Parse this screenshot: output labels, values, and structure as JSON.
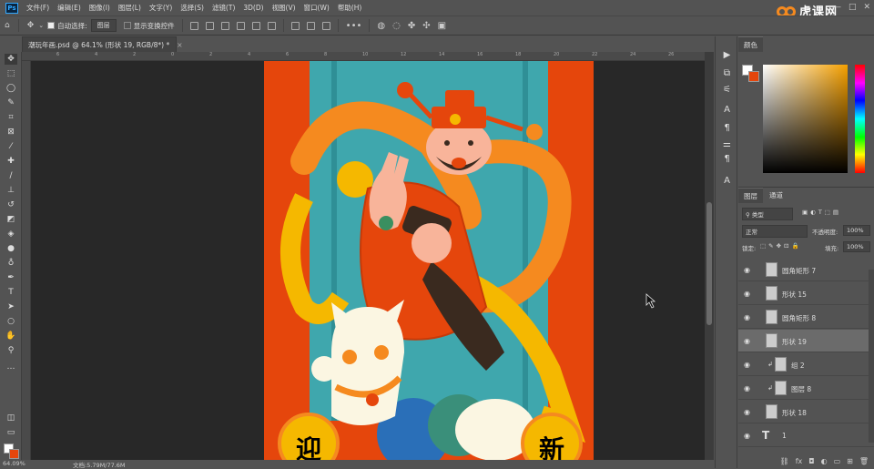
{
  "app": {
    "logo": "Ps",
    "menu": [
      "文件(F)",
      "编辑(E)",
      "图像(I)",
      "图层(L)",
      "文字(Y)",
      "选择(S)",
      "滤镜(T)",
      "3D(D)",
      "视图(V)",
      "窗口(W)",
      "帮助(H)"
    ],
    "brand": "虎课网",
    "window_controls": [
      "—",
      "□",
      "✕"
    ]
  },
  "options_bar": {
    "auto_select_label": "自动选择:",
    "auto_select_checked": true,
    "target_select": "图层",
    "show_transform_label": "显示变换控件",
    "show_transform_checked": false,
    "more": "•••"
  },
  "document": {
    "tab_title": "潮玩年画.psd @ 64.1% (形状 19, RGB/8*) *",
    "close": "×",
    "ruler_ticks": [
      "6",
      "4",
      "2",
      "0",
      "2",
      "4",
      "6",
      "8",
      "10",
      "12",
      "14",
      "16",
      "18",
      "20",
      "22",
      "24",
      "26"
    ]
  },
  "canvas": {
    "char_left": "迎",
    "char_right": "新",
    "colors": {
      "bg_red": "#e5460c",
      "teal": "#3fa7ad",
      "orange": "#f58a1f",
      "yellow": "#f5b800",
      "cream": "#fbf6e2"
    }
  },
  "status": {
    "zoom": "64.09%",
    "doc_size": "文档:5.79M/77.6M"
  },
  "color_panel": {
    "tabs": [
      "颜色"
    ],
    "fg": "#ffffff",
    "bg": "#e5460c",
    "hue": "#f5a000"
  },
  "layers_panel": {
    "tabs": [
      "图层",
      "通道"
    ],
    "filter_label": "类型",
    "blend_mode": "正常",
    "opacity_label": "不透明度:",
    "opacity": "100%",
    "lock_label": "锁定:",
    "fill_label": "填充:",
    "fill": "100%",
    "layers": [
      {
        "name": "圆角矩形 7",
        "type": "shape",
        "clipped": false,
        "selected": false
      },
      {
        "name": "形状 15",
        "type": "shape",
        "clipped": false,
        "selected": false
      },
      {
        "name": "圆角矩形 8",
        "type": "shape",
        "clipped": false,
        "selected": false
      },
      {
        "name": "形状 19",
        "type": "shape",
        "clipped": false,
        "selected": true
      },
      {
        "name": "组 2",
        "type": "group",
        "clipped": true,
        "selected": false
      },
      {
        "name": "图层 8",
        "type": "pixel",
        "clipped": true,
        "selected": false
      },
      {
        "name": "形状 18",
        "type": "shape",
        "clipped": false,
        "selected": false
      },
      {
        "name": "1",
        "type": "text",
        "clipped": false,
        "selected": false
      }
    ],
    "bottom_icons": [
      "link",
      "fx",
      "mask",
      "adjust",
      "folder",
      "new",
      "delete"
    ]
  }
}
